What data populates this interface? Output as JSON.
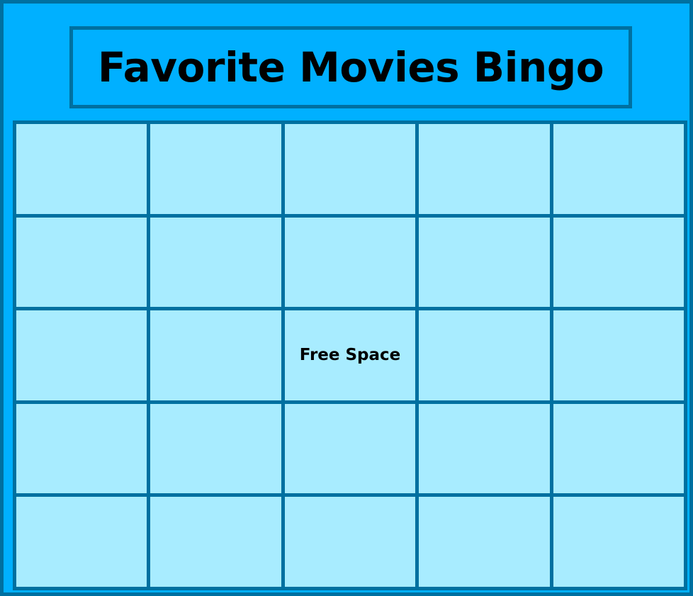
{
  "title": "Favorite Movies Bingo",
  "colors": {
    "background": "#00B0FF",
    "border": "#0070A0",
    "cell": "#A8ECFF",
    "text": "#000000"
  },
  "board": {
    "rows": [
      [
        "",
        "",
        "",
        "",
        ""
      ],
      [
        "",
        "",
        "",
        "",
        ""
      ],
      [
        "",
        "",
        "Free Space",
        "",
        ""
      ],
      [
        "",
        "",
        "",
        "",
        ""
      ],
      [
        "",
        "",
        "",
        "",
        ""
      ]
    ]
  }
}
